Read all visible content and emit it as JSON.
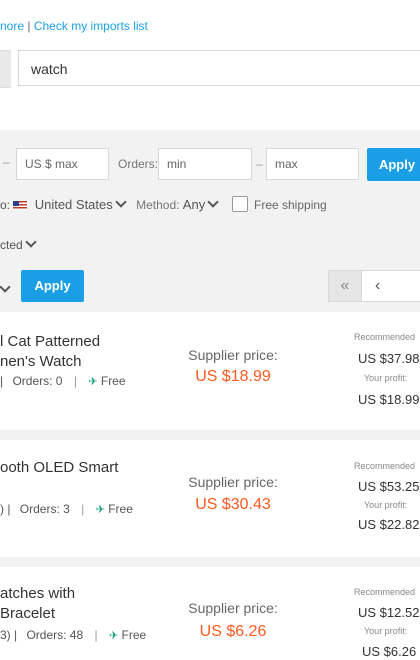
{
  "header": {
    "link_more": "nore",
    "link_separator": "|",
    "link_imports": "Check my imports list"
  },
  "search": {
    "value": "watch"
  },
  "filters": {
    "price_max_placeholder": "US $ max",
    "orders_label": "Orders:",
    "orders_min_placeholder": "min",
    "orders_max_placeholder": "max",
    "dash": "–",
    "apply_label": "Apply",
    "ship_to_label": "o:",
    "ship_to_value": "United States",
    "method_label": "Method:",
    "method_value": "Any",
    "free_shipping_label": "Free shipping",
    "sort_value": "cted"
  },
  "bulk": {
    "apply_label": "Apply"
  },
  "pager": {
    "first_icon": "«",
    "prev_icon": "‹"
  },
  "products": [
    {
      "title_line1": "l Cat Patterned",
      "title_line2": "nen's Watch",
      "meta_prefix": "|",
      "orders": "Orders: 0",
      "shipping": "Free",
      "supplier_label": "Supplier price:",
      "supplier_price": "US $18.99",
      "recommended_label": "Recommended",
      "recommended_price": "US $37.98",
      "profit_label": "Your profit:",
      "profit": "US $18.99"
    },
    {
      "title_line1": "ooth OLED Smart",
      "title_line2": "",
      "meta_prefix": ")  |",
      "orders": "Orders: 3",
      "shipping": "Free",
      "supplier_label": "Supplier price:",
      "supplier_price": "US $30.43",
      "recommended_label": "Recommended",
      "recommended_price": "US $53.25",
      "profit_label": "Your profit:",
      "profit": "US $22.82"
    },
    {
      "title_line1": "atches with",
      "title_line2": "Bracelet",
      "meta_prefix": "3)  |",
      "orders": "Orders: 48",
      "shipping": "Free",
      "supplier_label": "Supplier price:",
      "supplier_price": "US $6.26",
      "recommended_label": "Recommended",
      "recommended_price": "US $12.52",
      "profit_label": "Your profit:",
      "profit": "US $6.26"
    }
  ]
}
